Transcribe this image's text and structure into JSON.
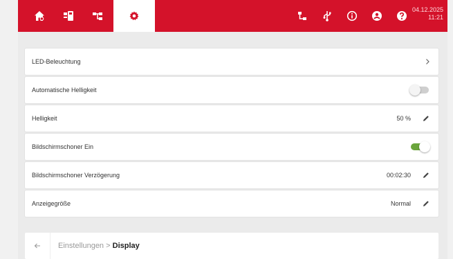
{
  "colors": {
    "brand_red": "#d4122a",
    "toggle_on": "#6aa53c",
    "toggle_off": "#cfcfcf"
  },
  "topbar": {
    "nav_left": [
      {
        "icon": "home-icon",
        "active": false
      },
      {
        "icon": "device-icon",
        "active": false
      },
      {
        "icon": "network-icon",
        "active": false
      },
      {
        "icon": "gear-icon",
        "active": true
      }
    ],
    "nav_right": [
      {
        "icon": "lan-icon"
      },
      {
        "icon": "usb-icon"
      },
      {
        "icon": "info-icon"
      },
      {
        "icon": "user-icon"
      },
      {
        "icon": "help-icon"
      }
    ],
    "date": "04.12.2025",
    "time": "11:21"
  },
  "settings": {
    "rows": [
      {
        "label": "LED-Beleuchtung",
        "control": "chevron"
      },
      {
        "label": "Automatische Helligkeit",
        "control": "toggle",
        "on": false
      },
      {
        "label": "Helligkeit",
        "control": "edit",
        "value": "50 %"
      },
      {
        "label": "Bildschirmschoner Ein",
        "control": "toggle",
        "on": true
      },
      {
        "label": "Bildschirmschoner Verzögerung",
        "control": "edit",
        "value": "00:02:30"
      },
      {
        "label": "Anzeigegröße",
        "control": "edit",
        "value": "Normal"
      }
    ]
  },
  "breadcrumb": {
    "parent": "Einstellungen",
    "separator": ">",
    "current": "Display"
  }
}
